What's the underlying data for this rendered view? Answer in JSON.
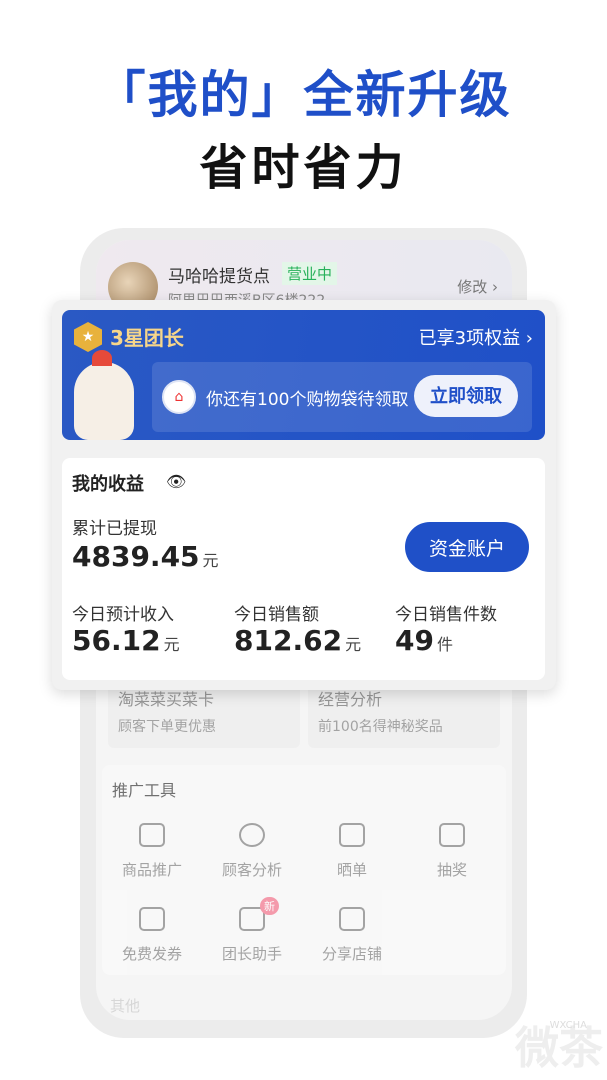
{
  "headline": {
    "line1": "「我的」全新升级",
    "line2": "省时省力"
  },
  "store": {
    "name": "马哈哈提货点",
    "status": "营业中",
    "address": "阿里巴巴西溪B区6楼222",
    "edit": "修改 ›"
  },
  "level": {
    "badge_icon": "star-medal",
    "title": "3星团长",
    "rights": "已享3项权益 ›",
    "bag_text": "你还有100个购物袋待领取",
    "claim": "立即领取"
  },
  "earnings": {
    "title": "我的收益",
    "withdrawn_label": "累计已提现",
    "withdrawn_value": "4839.45",
    "unit_yuan": "元",
    "account_button": "资金账户",
    "stats": [
      {
        "label": "今日预计收入",
        "value": "56.12",
        "unit": "元"
      },
      {
        "label": "今日销售额",
        "value": "812.62",
        "unit": "元"
      },
      {
        "label": "今日销售件数",
        "value": "49",
        "unit": "件"
      }
    ]
  },
  "cards": [
    {
      "title": "淘菜菜买菜卡",
      "sub": "顾客下单更优惠"
    },
    {
      "title": "经营分析",
      "sub": "前100名得神秘奖品"
    }
  ],
  "tools": {
    "title": "推广工具",
    "items": [
      "商品推广",
      "顾客分析",
      "晒单",
      "抽奖",
      "免费发券",
      "团长助手",
      "分享店铺"
    ],
    "new_badge": "新"
  },
  "other": "其他",
  "watermark": {
    "cn": "微茶",
    "en": "WXCHA"
  },
  "colors": {
    "brand": "#1f50c8",
    "gold": "#f7d68a",
    "green": "#27b15a"
  }
}
